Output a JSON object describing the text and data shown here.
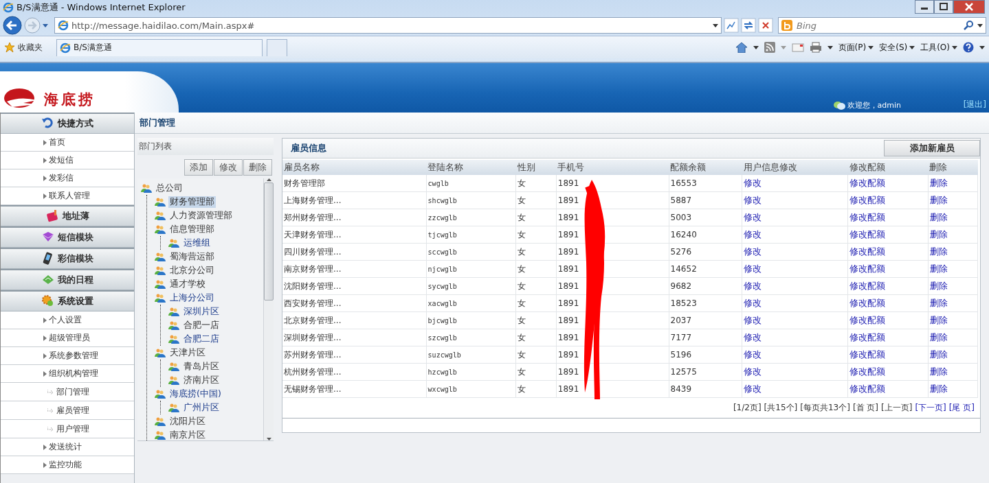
{
  "browser": {
    "title": "B/S满意通 - Windows Internet Explorer",
    "address": "http://message.haidilao.com/Main.aspx#",
    "search_placeholder": "Bing",
    "favorites": "收藏夹",
    "tab_label": "B/S满意通",
    "menus": [
      "页面(P)",
      "安全(S)",
      "工具(O)"
    ]
  },
  "header": {
    "logo_text": "海底捞",
    "welcome": "欢迎您，admin",
    "logout": "[退出]"
  },
  "sidebar": [
    {
      "label": "快捷方式",
      "expanded": true,
      "items": [
        {
          "label": "首页"
        },
        {
          "label": "发短信"
        },
        {
          "label": "发彩信"
        },
        {
          "label": "联系人管理"
        }
      ]
    },
    {
      "label": "地址薄",
      "expanded": false
    },
    {
      "label": "短信模块",
      "expanded": false
    },
    {
      "label": "彩信模块",
      "expanded": false
    },
    {
      "label": "我的日程",
      "expanded": false
    },
    {
      "label": "系统设置",
      "expanded": true,
      "items": [
        {
          "label": "个人设置"
        },
        {
          "label": "超级管理员"
        },
        {
          "label": "系统参数管理"
        },
        {
          "label": "组织机构管理",
          "children": [
            {
              "label": "部门管理"
            },
            {
              "label": "雇员管理"
            },
            {
              "label": "用户管理"
            }
          ]
        },
        {
          "label": "发送统计"
        },
        {
          "label": "监控功能"
        }
      ]
    }
  ],
  "page_title": "部门管理",
  "dept_panel": {
    "title": "部门列表",
    "buttons": [
      "添加",
      "修改",
      "删除"
    ],
    "tree": [
      {
        "label": "总公司",
        "selected": false,
        "visited": false,
        "children": [
          {
            "label": "财务管理部",
            "selected": true,
            "visited": false
          },
          {
            "label": "人力资源管理部",
            "selected": false,
            "visited": false
          },
          {
            "label": "信息管理部",
            "selected": false,
            "visited": false,
            "children": [
              {
                "label": "运维组",
                "selected": false,
                "visited": true
              }
            ]
          },
          {
            "label": "蜀海营运部",
            "selected": false,
            "visited": false
          },
          {
            "label": "北京分公司",
            "selected": false,
            "visited": false
          },
          {
            "label": "通才学校",
            "selected": false,
            "visited": false
          },
          {
            "label": "上海分公司",
            "selected": false,
            "visited": true,
            "children": [
              {
                "label": "深圳片区",
                "selected": false,
                "visited": true
              },
              {
                "label": "合肥一店",
                "selected": false,
                "visited": false
              },
              {
                "label": "合肥二店",
                "selected": false,
                "visited": true
              }
            ]
          },
          {
            "label": "天津片区",
            "selected": false,
            "visited": false,
            "children": [
              {
                "label": "青岛片区",
                "selected": false,
                "visited": false
              },
              {
                "label": "济南片区",
                "selected": false,
                "visited": false
              }
            ]
          },
          {
            "label": "海底捞(中国)",
            "selected": false,
            "visited": true,
            "children": [
              {
                "label": "广州片区",
                "selected": false,
                "visited": true
              }
            ]
          },
          {
            "label": "沈阳片区",
            "selected": false,
            "visited": false
          },
          {
            "label": "南京片区",
            "selected": false,
            "visited": false
          }
        ]
      }
    ]
  },
  "staff_table": {
    "title": "雇员信息",
    "add_button": "添加新雇员",
    "columns": [
      "雇员名称",
      "登陆名称",
      "性别",
      "手机号",
      "配额余额",
      "用户信息修改",
      "修改配额",
      "删除"
    ],
    "rows": [
      [
        "财务管理部",
        "cwglb",
        "女",
        "1891",
        "16553",
        "修改",
        "修改配额",
        "删除"
      ],
      [
        "上海财务管理...",
        "shcwglb",
        "女",
        "1891",
        "5887",
        "修改",
        "修改配额",
        "删除"
      ],
      [
        "郑州财务管理...",
        "zzcwglb",
        "女",
        "1891",
        "5003",
        "修改",
        "修改配额",
        "删除"
      ],
      [
        "天津财务管理...",
        "tjcwglb",
        "女",
        "1891",
        "16240",
        "修改",
        "修改配额",
        "删除"
      ],
      [
        "四川财务管理...",
        "sccwglb",
        "女",
        "1891",
        "5276",
        "修改",
        "修改配额",
        "删除"
      ],
      [
        "南京财务管理...",
        "njcwglb",
        "女",
        "1891",
        "14652",
        "修改",
        "修改配额",
        "删除"
      ],
      [
        "沈阳财务管理...",
        "sycwglb",
        "女",
        "1891",
        "9682",
        "修改",
        "修改配额",
        "删除"
      ],
      [
        "西安财务管理...",
        "xacwglb",
        "女",
        "1891",
        "18523",
        "修改",
        "修改配额",
        "删除"
      ],
      [
        "北京财务管理...",
        "bjcwglb",
        "女",
        "1891",
        "2037",
        "修改",
        "修改配额",
        "删除"
      ],
      [
        "深圳财务管理...",
        "szcwglb",
        "女",
        "1891",
        "7177",
        "修改",
        "修改配额",
        "删除"
      ],
      [
        "苏州财务管理...",
        "suzcwglb",
        "女",
        "1891",
        "5196",
        "修改",
        "修改配额",
        "删除"
      ],
      [
        "杭州财务管理...",
        "hzcwglb",
        "女",
        "1891",
        "12575",
        "修改",
        "修改配额",
        "删除"
      ],
      [
        "无锡财务管理...",
        "wxcwglb",
        "女",
        "1891",
        "8439",
        "修改",
        "修改配额",
        "删除"
      ]
    ],
    "pager": [
      {
        "text": "[1/2页]",
        "link": false
      },
      {
        "text": "[共15个]",
        "link": false
      },
      {
        "text": "[每页共13个]",
        "link": false
      },
      {
        "text": "[首 页]",
        "link": false
      },
      {
        "text": "[上一页]",
        "link": false
      },
      {
        "text": "[下一页]",
        "link": true
      },
      {
        "text": "[尾 页]",
        "link": true
      }
    ]
  }
}
